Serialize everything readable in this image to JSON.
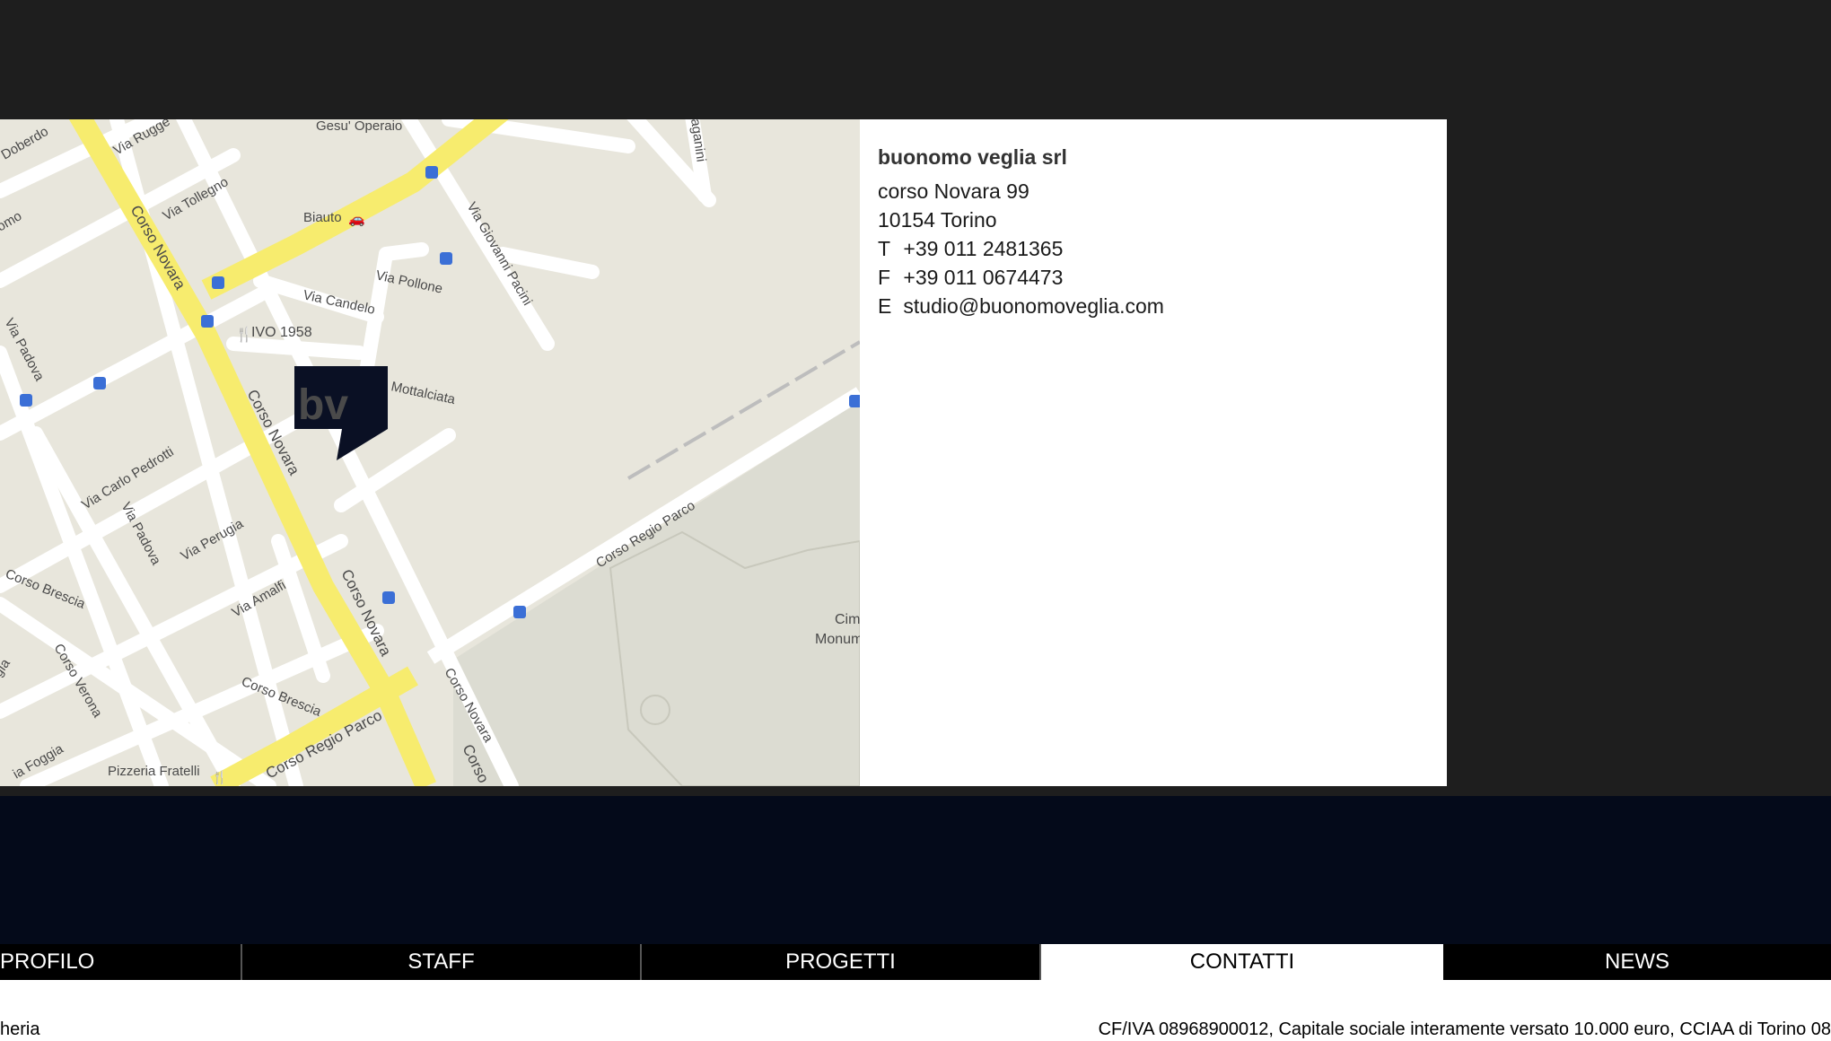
{
  "map": {
    "labels": {
      "gesu_operaio": "Gesu' Operaio",
      "via_ruggeri": "Via Rugge",
      "via_doberdo": "Doberdo",
      "via_tollegno": "Via Tollegno",
      "biauto": "Biauto",
      "corso_novara_1": "Corso Novara",
      "corso_novara_2": "Corso Novara",
      "corso_novara_3": "Corso Novara",
      "corso_novara_4": "Corso Novara",
      "corso_novara_5": "Corso",
      "via_candelo": "Via Candelo",
      "via_pollone": "Via Pollone",
      "via_giovanni_pacini": "Via Giovanni Pacini",
      "ivo_1958": "IVO 1958",
      "via_padova_1": "Via Padova",
      "via_padova_2": "Via Padova",
      "via_mottalciata": "Mottalciata",
      "via_carlo_pedrotti": "Via Carlo Pedrotti",
      "via_perugia": "Via Perugia",
      "via_amalfi": "Via Amalfi",
      "corso_brescia_1": "Corso Brescia",
      "corso_brescia_2": "Corso Brescia",
      "corso_regio_parco_1": "Corso Regio Parco",
      "corso_regio_parco_2": "Corso Regio Parco",
      "corso_verona": "Corso Verona",
      "via_foggia": "ia Foggia",
      "pizzeria_fratelli": "Pizzeria Fratelli",
      "cimitero": "Cim",
      "monumentale": "Monum",
      "paganini": "aganini",
      "mo": "omo",
      "gia": "gia"
    },
    "marker_text": "bv"
  },
  "contact": {
    "company": "buonomo veglia srl",
    "address": "corso Novara 99",
    "city": "10154 Torino",
    "phone_label": "T",
    "phone": "+39 011 2481365",
    "fax_label": "F",
    "fax": "+39 011 0674473",
    "email_label": "E",
    "email": "studio@buonomoveglia.com"
  },
  "nav": {
    "items": [
      {
        "label": "PROFILO"
      },
      {
        "label": "STAFF"
      },
      {
        "label": "PROGETTI"
      },
      {
        "label": "CONTATTI"
      },
      {
        "label": "NEWS"
      }
    ]
  },
  "footer": {
    "left_text": "heria",
    "right_text": "CF/IVA 08968900012, Capitale sociale interamente versato 10.000 euro, CCIAA di Torino 08"
  },
  "colors": {
    "page_bg": "#1e1e1e",
    "navy_band": "#040a1a",
    "nav_bar": "#000000",
    "active_tab": "#ffffff",
    "major_road": "#f7ec6e",
    "map_bg": "#e8e6dc",
    "marker": "#0a1024"
  }
}
